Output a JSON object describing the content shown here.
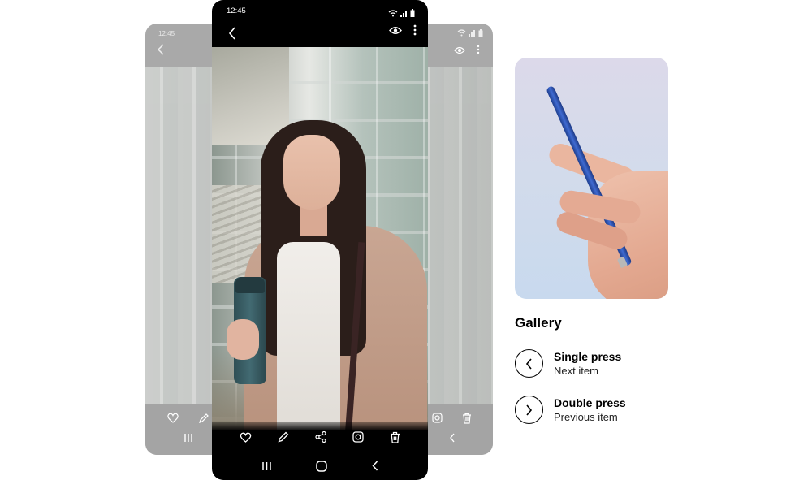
{
  "status_bar": {
    "time": "12:45",
    "icons": [
      "wifi-icon",
      "signal-icon",
      "battery-icon"
    ]
  },
  "top_bar": {
    "back_icon": "chevron-left-icon",
    "view_icon": "eye-icon",
    "more_icon": "more-vertical-icon"
  },
  "action_bar": {
    "icons": [
      "heart-icon",
      "pencil-icon",
      "share-icon",
      "instagram-icon",
      "trash-icon"
    ]
  },
  "nav_bar": {
    "icons": [
      "recent-apps-icon",
      "home-icon",
      "back-icon"
    ]
  },
  "panel": {
    "title": "Gallery",
    "items": [
      {
        "icon": "chevron-left-icon",
        "title": "Single press",
        "subtitle": "Next item"
      },
      {
        "icon": "chevron-right-icon",
        "title": "Double press",
        "subtitle": "Previous item"
      }
    ]
  },
  "colors": {
    "phone_bg": "#000000",
    "ghost_phone": "#a9a9a9",
    "pen_blue": "#3a62c4",
    "text": "#000000"
  }
}
